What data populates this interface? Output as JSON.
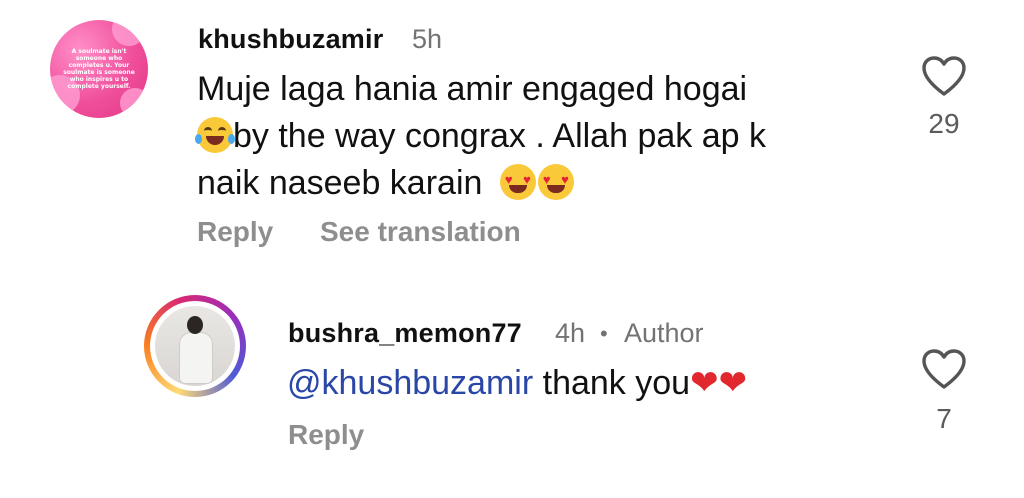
{
  "comments": [
    {
      "avatar_text": "A soulmate isn't someone who completes u. Your soulmate is someone who inspires u to complete yourself.",
      "username": "khushbuzamir",
      "time": "5h",
      "lines": [
        "Muje laga hania amir engaged hogai",
        "by the way congrax . Allah pak ap k",
        "naik naseeb karain"
      ],
      "actions": {
        "reply": "Reply",
        "translate": "See translation"
      },
      "like_icon": "heart-outline-icon",
      "likes": "29"
    },
    {
      "username": "bushra_memon77",
      "time": "4h",
      "separator": "•",
      "badge": "Author",
      "mention": "@khushbuzamir",
      "text": " thank you",
      "actions": {
        "reply": "Reply"
      },
      "like_icon": "heart-outline-icon",
      "likes": "7"
    }
  ],
  "colors": {
    "mention": "#2a47a8",
    "meta": "#737373",
    "action": "#8e8e8e",
    "heart": "#e0282e"
  }
}
